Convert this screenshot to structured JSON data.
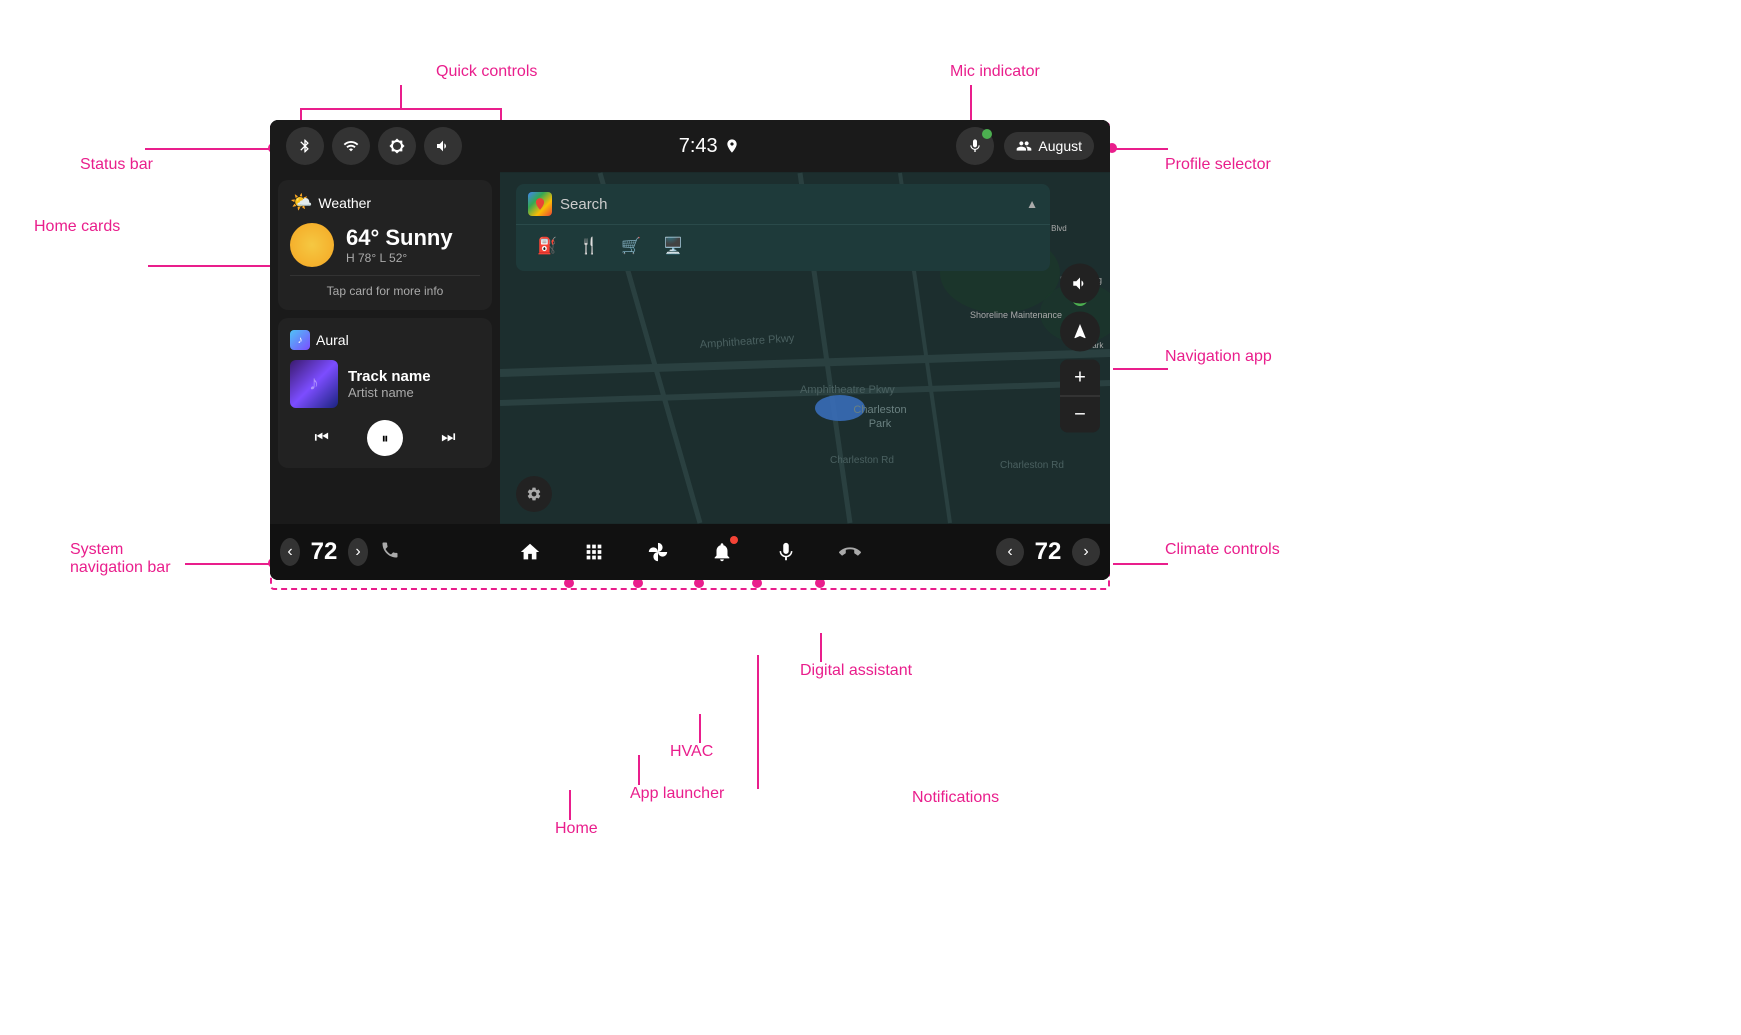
{
  "annotations": {
    "quick_controls": "Quick controls",
    "mic_indicator": "Mic indicator",
    "status_bar": "Status bar",
    "profile_selector": "Profile selector",
    "home_cards": "Home cards",
    "navigation_app": "Navigation app",
    "system_navigation_bar": "System\nnavigation bar",
    "climate_controls": "Climate controls",
    "home": "Home",
    "app_launcher": "App launcher",
    "hvac": "HVAC",
    "notifications": "Notifications",
    "digital_assistant": "Digital assistant"
  },
  "status_bar": {
    "time": "7:43",
    "profile_name": "August"
  },
  "weather_card": {
    "title": "Weather",
    "temp": "64° Sunny",
    "hl": "H 78° L 52°",
    "tap_info": "Tap card for more info"
  },
  "music_card": {
    "app_name": "Aural",
    "track_name": "Track name",
    "artist_name": "Artist name"
  },
  "search": {
    "placeholder": "Search"
  },
  "climate": {
    "left_temp": "72",
    "right_temp": "72"
  }
}
